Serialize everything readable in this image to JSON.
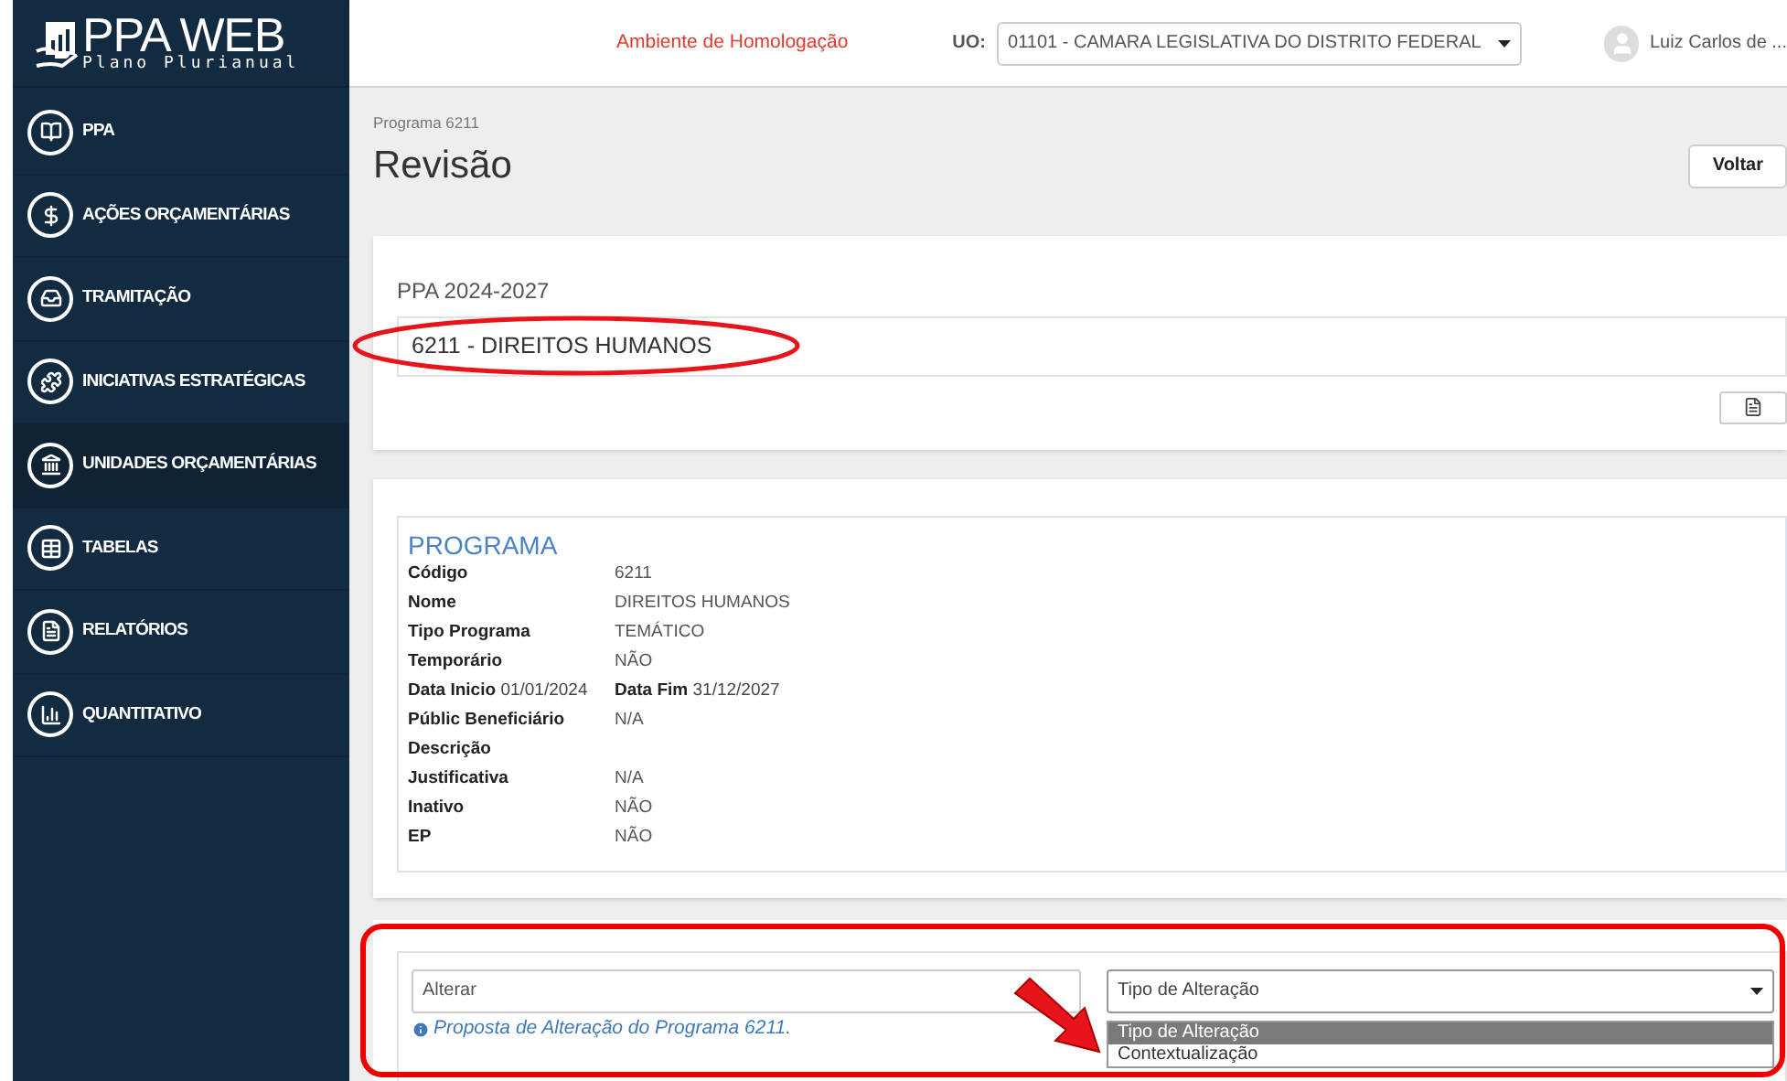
{
  "logo": {
    "title": "PPA WEB",
    "subtitle": "Plano Plurianual"
  },
  "sidebar": {
    "items": [
      {
        "label": "PPA",
        "selected": false
      },
      {
        "label": "AÇÕES ORÇAMENTÁRIAS",
        "selected": false
      },
      {
        "label": "TRAMITAÇÃO",
        "selected": false
      },
      {
        "label": "INICIATIVAS ESTRATÉGICAS",
        "selected": false
      },
      {
        "label": "UNIDADES ORÇAMENTÁRIAS",
        "selected": true
      },
      {
        "label": "TABELAS",
        "selected": false
      },
      {
        "label": "RELATÓRIOS",
        "selected": false
      },
      {
        "label": "QUANTITATIVO",
        "selected": false
      }
    ]
  },
  "top_bar": {
    "environment": "Ambiente de Homologação",
    "uo_label": "UO:",
    "uo_value": "01101 - CAMARA LEGISLATIVA DO DISTRITO FEDERAL",
    "user_name": "Luiz Carlos de ..."
  },
  "page": {
    "breadcrumb": "Programa 6211",
    "title": "Revisão",
    "back_button": "Voltar"
  },
  "ppa_card": {
    "heading": "PPA 2024-2027",
    "program": "6211 - DIREITOS HUMANOS"
  },
  "programa": {
    "heading": "PROGRAMA",
    "rows": [
      {
        "kind": "pair",
        "label": "Código",
        "value": "6211"
      },
      {
        "kind": "pair",
        "label": "Nome",
        "value": "DIREITOS HUMANOS"
      },
      {
        "kind": "pair",
        "label": "Tipo Programa",
        "value": "TEMÁTICO"
      },
      {
        "kind": "pair",
        "label": "Temporário",
        "value": "NÃO"
      },
      {
        "kind": "dates",
        "label": "Data Inicio",
        "value": "01/01/2024",
        "label_2": "Data Fim",
        "value_2": "31/12/2027"
      },
      {
        "kind": "pair",
        "label": "Públic Beneficiário",
        "value": "N/A"
      },
      {
        "kind": "pair",
        "label": "Descrição"
      },
      {
        "kind": "pair",
        "label": "Justificativa",
        "value": "N/A"
      },
      {
        "kind": "pair",
        "label": "Inativo",
        "value": "NÃO"
      },
      {
        "kind": "pair",
        "label": "EP",
        "value": "NÃO"
      }
    ]
  },
  "alteracao": {
    "action_select": "Alterar",
    "info": "Proposta de Alteração do Programa 6211.",
    "type_select": "Tipo de Alteração",
    "options": [
      {
        "label": "Tipo de Alteração",
        "selected": true
      },
      {
        "label": "Contextualização",
        "selected": false
      }
    ]
  }
}
